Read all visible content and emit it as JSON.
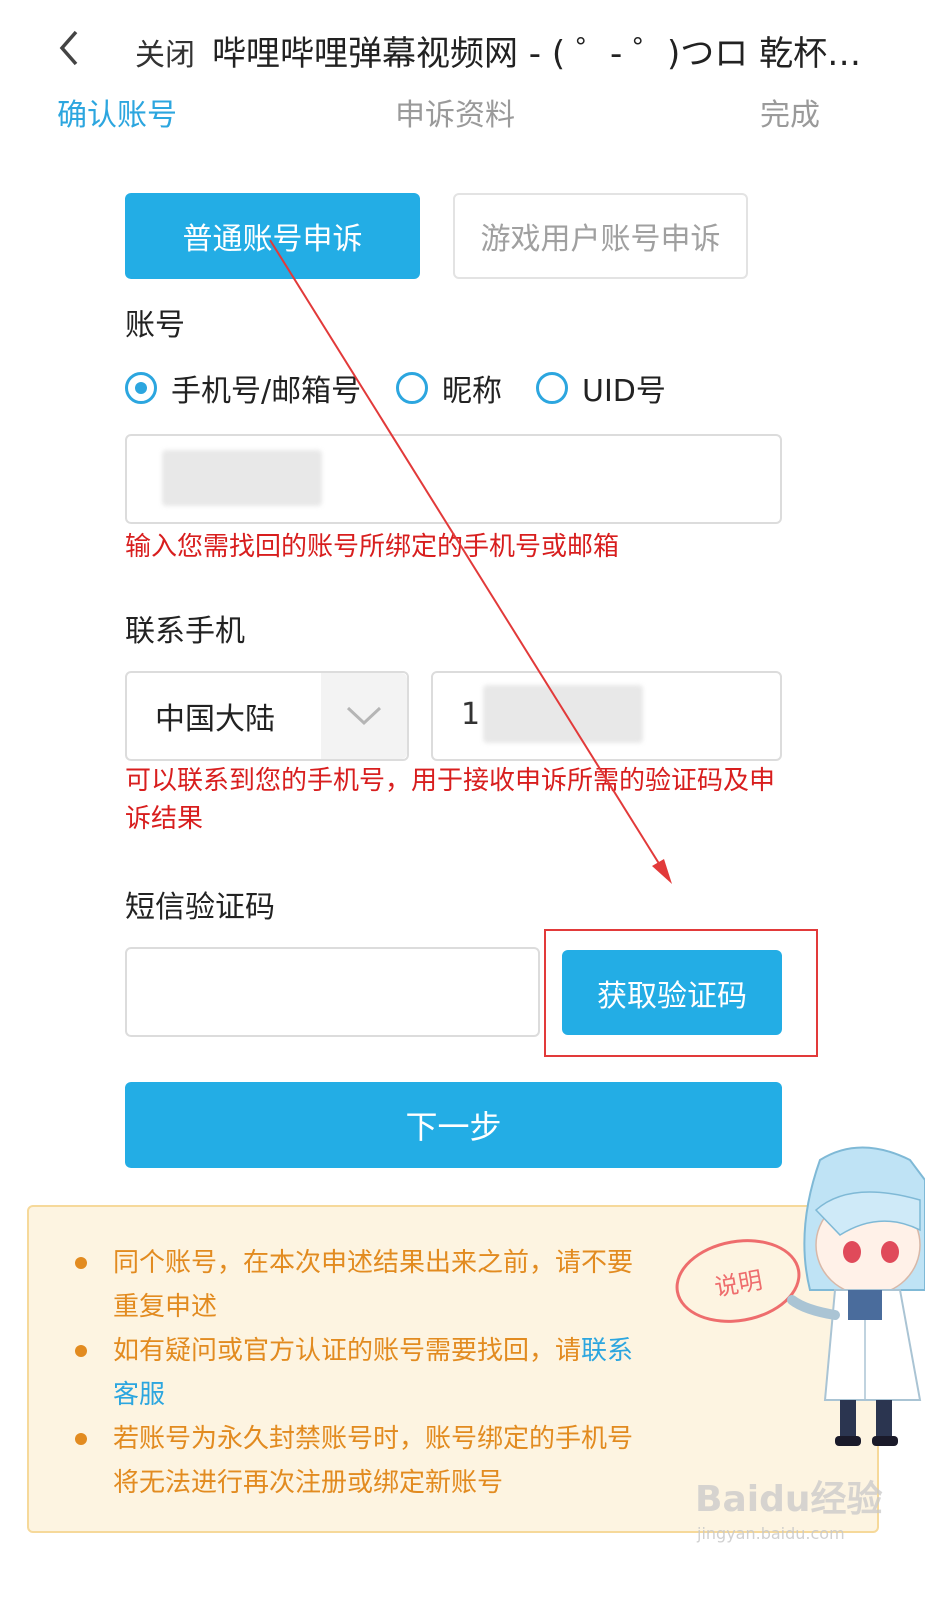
{
  "header": {
    "close_label": "关闭",
    "title": "哔哩哔哩弹幕视频网 - ( ゜- ゜)つロ 乾杯~ - bilibili"
  },
  "steps": [
    "确认账号",
    "申诉资料",
    "完成"
  ],
  "tabs": {
    "normal": "普通账号申诉",
    "game": "游戏用户账号申诉"
  },
  "account": {
    "label": "账号",
    "radio_options": [
      "手机号/邮箱号",
      "昵称",
      "UID号"
    ],
    "selected": "手机号/邮箱号",
    "hint": "输入您需找回的账号所绑定的手机号或邮箱"
  },
  "contact": {
    "label": "联系手机",
    "region": "中国大陆",
    "phone_prefix": "1",
    "hint_line1": "可以联系到您的手机号，用于接收申诉所需的验证码及申",
    "hint_line2": "诉结果"
  },
  "sms": {
    "label": "短信验证码",
    "get_code_button": "获取验证码"
  },
  "next_button": "下一步",
  "notice": {
    "item1_line1": "同个账号，在本次申述结果出来之前，请不要",
    "item1_line2": "重复申述",
    "item2_line1_text": "如有疑问或官方认证的账号需要找回，请",
    "item2_link_part1": "联系",
    "item2_link_part2": "客服",
    "item3_line1": "若账号为永久封禁账号时，账号绑定的手机号",
    "item3_line2": "将无法进行再次注册或绑定新账号",
    "stamp": "说明"
  },
  "watermark": {
    "main": "Baidu经验",
    "sub": "jingyan.baidu.com"
  },
  "colors": {
    "accent": "#23ade5",
    "hint_red": "#d81e1e",
    "notice_orange": "#e28b20",
    "annotation_red": "#e23a3a"
  }
}
